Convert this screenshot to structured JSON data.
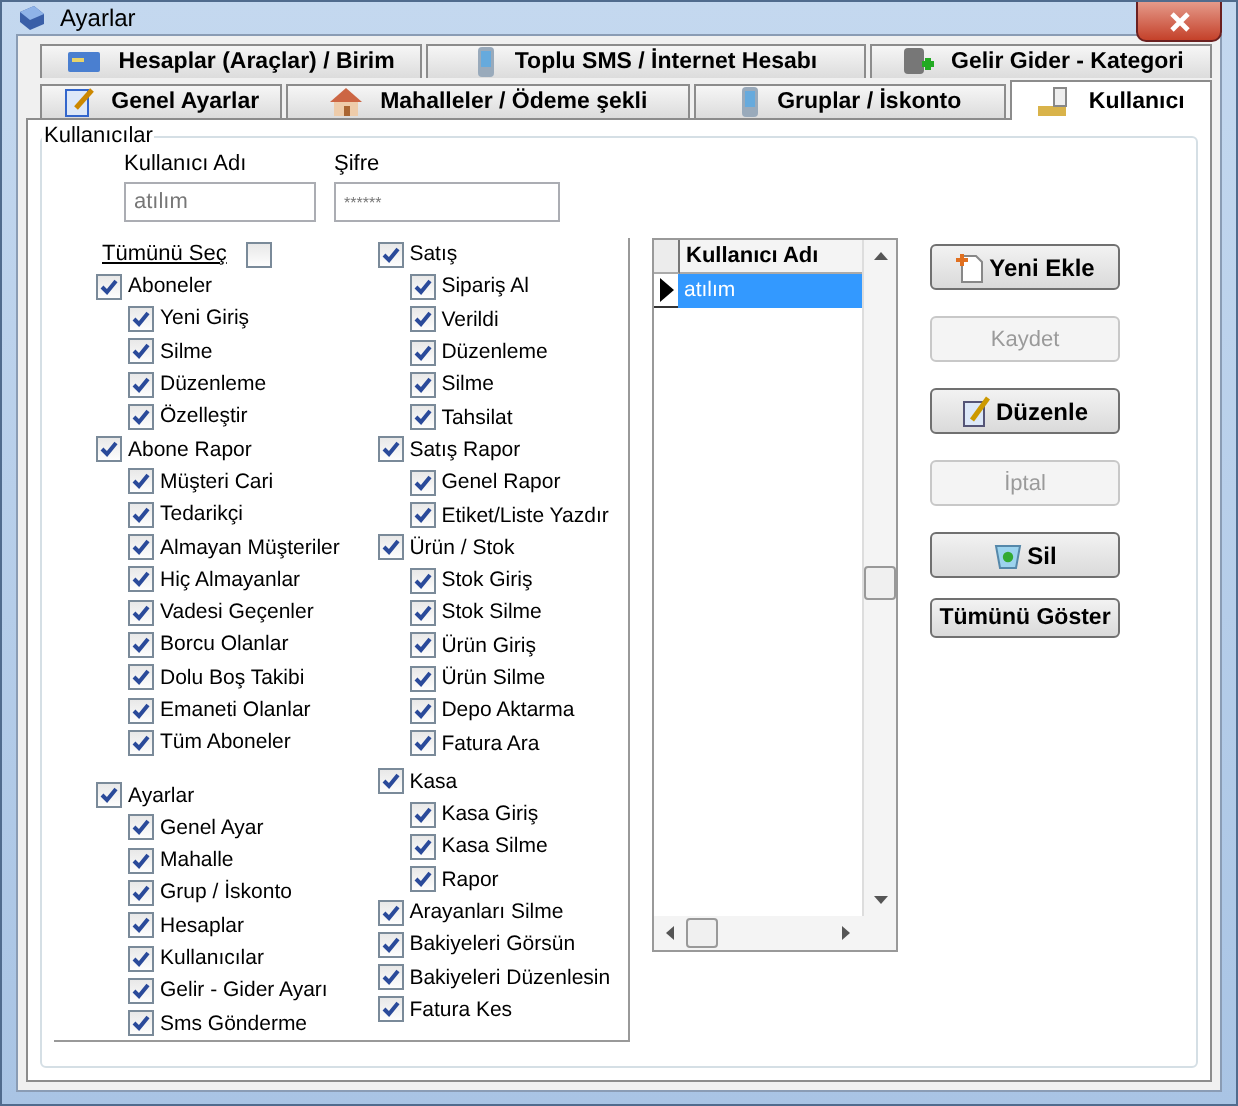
{
  "window": {
    "title": "Ayarlar"
  },
  "tab_rows": [
    [
      {
        "label": "Hesaplar (Araçlar) / Birim",
        "selected": false
      },
      {
        "label": "Toplu SMS / İnternet Hesabı",
        "selected": false
      },
      {
        "label": "Gelir Gider - Kategori",
        "selected": false
      }
    ],
    [
      {
        "label": "Genel Ayarlar",
        "selected": false
      },
      {
        "label": "Mahalleler / Ödeme şekli",
        "selected": false
      },
      {
        "label": "Gruplar / İskonto",
        "selected": false
      },
      {
        "label": "Kullanıcı",
        "selected": true
      }
    ]
  ],
  "group_title": "Kullanıcılar",
  "fields": [
    {
      "label": "Kullanıcı Adı",
      "value": "atılım"
    },
    {
      "label": "Şifre",
      "value": "******"
    }
  ],
  "select_all": {
    "label": "Tümünü Seç",
    "checked": false
  },
  "permission_columns": [
    [
      {
        "label": "Aboneler",
        "checked": true,
        "children": [
          {
            "label": "Yeni Giriş",
            "checked": true
          },
          {
            "label": "Silme",
            "checked": true
          },
          {
            "label": "Düzenleme",
            "checked": true
          },
          {
            "label": "Özelleştir",
            "checked": true
          }
        ]
      },
      {
        "label": "Abone Rapor",
        "checked": true,
        "children": [
          {
            "label": "Müşteri Cari",
            "checked": true
          },
          {
            "label": "Tedarikçi",
            "checked": true
          },
          {
            "label": "Almayan Müşteriler",
            "checked": true
          },
          {
            "label": "Hiç Almayanlar",
            "checked": true
          },
          {
            "label": "Vadesi Geçenler",
            "checked": true
          },
          {
            "label": "Borcu Olanlar",
            "checked": true
          },
          {
            "label": "Dolu Boş Takibi",
            "checked": true
          },
          {
            "label": "Emaneti Olanlar",
            "checked": true
          },
          {
            "label": "Tüm Aboneler",
            "checked": true
          }
        ]
      },
      {
        "label": "Ayarlar",
        "checked": true,
        "children": [
          {
            "label": "Genel Ayar",
            "checked": true
          },
          {
            "label": "Mahalle",
            "checked": true
          },
          {
            "label": "Grup / İskonto",
            "checked": true
          },
          {
            "label": "Hesaplar",
            "checked": true
          },
          {
            "label": "Kullanıcılar",
            "checked": true
          },
          {
            "label": "Gelir - Gider Ayarı",
            "checked": true
          },
          {
            "label": "Sms Gönderme",
            "checked": true
          }
        ]
      }
    ],
    [
      {
        "label": "Satış",
        "checked": true,
        "children": [
          {
            "label": "Sipariş Al",
            "checked": true
          },
          {
            "label": "Verildi",
            "checked": true
          },
          {
            "label": "Düzenleme",
            "checked": true
          },
          {
            "label": "Silme",
            "checked": true
          },
          {
            "label": "Tahsilat",
            "checked": true
          }
        ]
      },
      {
        "label": "Satış Rapor",
        "checked": true,
        "children": [
          {
            "label": "Genel Rapor",
            "checked": true
          },
          {
            "label": "Etiket/Liste Yazdır",
            "checked": true
          }
        ]
      },
      {
        "label": "Ürün / Stok",
        "checked": true,
        "children": [
          {
            "label": "Stok Giriş",
            "checked": true
          },
          {
            "label": "Stok Silme",
            "checked": true
          },
          {
            "label": "Ürün Giriş",
            "checked": true
          },
          {
            "label": "Ürün Silme",
            "checked": true
          },
          {
            "label": "Depo Aktarma",
            "checked": true
          },
          {
            "label": "Fatura Ara",
            "checked": true
          }
        ]
      },
      {
        "label": "Kasa",
        "checked": true,
        "children": [
          {
            "label": "Kasa Giriş",
            "checked": true
          },
          {
            "label": "Kasa Silme",
            "checked": true
          },
          {
            "label": "Rapor",
            "checked": true
          }
        ]
      },
      {
        "label": "Arayanları Silme",
        "checked": true
      },
      {
        "label": "Bakiyeleri Görsün",
        "checked": true
      },
      {
        "label": "Bakiyeleri Düzenlesin",
        "checked": true
      },
      {
        "label": "Fatura Kes",
        "checked": true
      }
    ]
  ],
  "grid": {
    "column": "Kullanıcı Adı",
    "rows": [
      {
        "value": "atılım",
        "selected": true
      }
    ]
  },
  "buttons": [
    {
      "label": "Yeni Ekle",
      "disabled": false
    },
    {
      "label": "Kaydet",
      "disabled": true
    },
    {
      "label": "Düzenle",
      "disabled": false
    },
    {
      "label": "İptal",
      "disabled": true
    },
    {
      "label": "Sil",
      "disabled": false
    },
    {
      "label": "Tümünü Göster",
      "disabled": false
    }
  ]
}
